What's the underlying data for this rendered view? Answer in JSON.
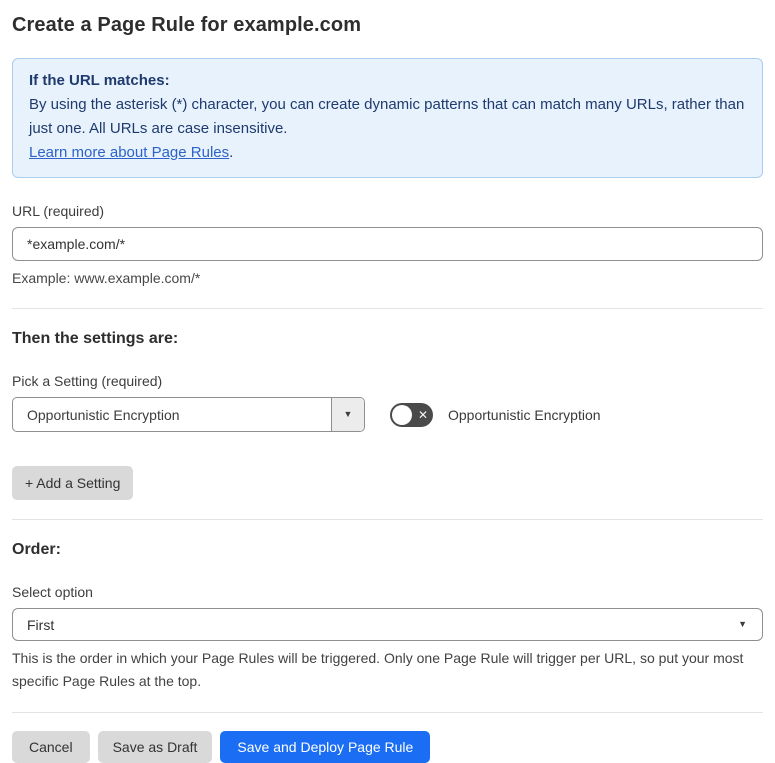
{
  "page": {
    "title": "Create a Page Rule for example.com"
  },
  "info_box": {
    "heading": "If the URL matches:",
    "body": "By using the asterisk (*) character, you can create dynamic patterns that can match many URLs, rather than just one. All URLs are case insensitive.",
    "link": "Learn more about Page Rules",
    "link_suffix": "."
  },
  "url_field": {
    "label": "URL (required)",
    "value": "*example.com/*",
    "helper": "Example: www.example.com/*"
  },
  "settings_section": {
    "heading": "Then the settings are:",
    "picker_label": "Pick a Setting (required)",
    "picker_value": "Opportunistic Encryption",
    "toggle_state": "off",
    "toggle_label": "Opportunistic Encryption",
    "add_setting_button": "+ Add a Setting"
  },
  "order_section": {
    "heading": "Order:",
    "select_label": "Select option",
    "select_value": "First",
    "helper": "This is the order in which your Page Rules will be triggered. Only one Page Rule will trigger per URL, so put your most specific Page Rules at the top."
  },
  "footer": {
    "cancel_label": "Cancel",
    "save_draft_label": "Save as Draft",
    "save_deploy_label": "Save and Deploy Page Rule"
  },
  "icons": {
    "chevron_down": "▼",
    "toggle_x": "✕"
  },
  "colors": {
    "info_bg": "#e8f2fc",
    "info_border": "#abcdf0",
    "info_text": "#1e3a6e",
    "link": "#2c62c9",
    "primary_button": "#1b6ef3",
    "toggle_off_bg": "#4a4a4a",
    "secondary_button_bg": "#d9d9d9"
  }
}
